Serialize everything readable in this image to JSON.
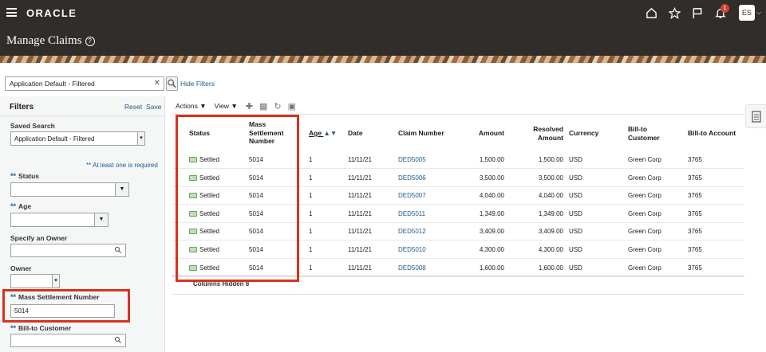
{
  "brand": {
    "logo": "ORACLE",
    "accent": "#312d2a",
    "highlight": "#d8321c",
    "link": "#1e5c8a"
  },
  "topbar": {
    "notification_count": "1",
    "avatar_initials": "ES"
  },
  "page": {
    "title": "Manage Claims"
  },
  "search": {
    "value": "Application Default - Filtered",
    "hide_filters": "Hide Filters"
  },
  "filters": {
    "heading": "Filters",
    "reset": "Reset",
    "save": "Save",
    "saved_search_label": "Saved Search",
    "saved_search_value": "Application Default - Filtered",
    "required_note": "** At least one is required",
    "required_mark": "**",
    "status_label": "Status",
    "status_value": "",
    "age_label": "Age",
    "age_value": "",
    "owner_spec_label": "Specify an Owner",
    "owner_spec_value": "",
    "owner_label": "Owner",
    "owner_value": "",
    "mass_label": "Mass Settlement Number",
    "mass_value": "5014",
    "bill_to_label": "Bill-to Customer",
    "bill_to_value": ""
  },
  "toolbar": {
    "actions": "Actions",
    "view": "View"
  },
  "table": {
    "headers": {
      "status": "Status",
      "mass1": "Mass",
      "mass2": "Settlement",
      "mass3": "Number",
      "age": "Age",
      "date": "Date",
      "claim_number": "Claim Number",
      "amount": "Amount",
      "resolved1": "Resolved",
      "resolved2": "Amount",
      "currency": "Currency",
      "billto1": "Bill-to",
      "billto2": "Customer",
      "bill_account": "Bill-to Account"
    },
    "rows": [
      {
        "status": "Settled",
        "mass": "5014",
        "age": "1",
        "date": "11/11/21",
        "claim": "DED5005",
        "amount": "1,500.00",
        "resolved": "1,500.00",
        "currency": "USD",
        "customer": "Green Corp",
        "account": "3765"
      },
      {
        "status": "Settled",
        "mass": "5014",
        "age": "1",
        "date": "11/11/21",
        "claim": "DED5006",
        "amount": "3,500.00",
        "resolved": "3,500.00",
        "currency": "USD",
        "customer": "Green Corp",
        "account": "3765"
      },
      {
        "status": "Settled",
        "mass": "5014",
        "age": "1",
        "date": "11/11/21",
        "claim": "DED5007",
        "amount": "4,040.00",
        "resolved": "4,040.00",
        "currency": "USD",
        "customer": "Green Corp",
        "account": "3765"
      },
      {
        "status": "Settled",
        "mass": "5014",
        "age": "1",
        "date": "11/11/21",
        "claim": "DED5011",
        "amount": "1,349.00",
        "resolved": "1,349.00",
        "currency": "USD",
        "customer": "Green Corp",
        "account": "3765"
      },
      {
        "status": "Settled",
        "mass": "5014",
        "age": "1",
        "date": "11/11/21",
        "claim": "DED5012",
        "amount": "3,409.00",
        "resolved": "3,409.00",
        "currency": "USD",
        "customer": "Green Corp",
        "account": "3765"
      },
      {
        "status": "Settled",
        "mass": "5014",
        "age": "1",
        "date": "11/11/21",
        "claim": "DED5010",
        "amount": "4,300.00",
        "resolved": "4,300.00",
        "currency": "USD",
        "customer": "Green Corp",
        "account": "3765"
      },
      {
        "status": "Settled",
        "mass": "5014",
        "age": "1",
        "date": "11/11/21",
        "claim": "DED5008",
        "amount": "1,600.00",
        "resolved": "1,600.00",
        "currency": "USD",
        "customer": "Green Corp",
        "account": "3765"
      }
    ],
    "columns_hidden_label": "Columns Hidden",
    "columns_hidden_count": "8"
  }
}
